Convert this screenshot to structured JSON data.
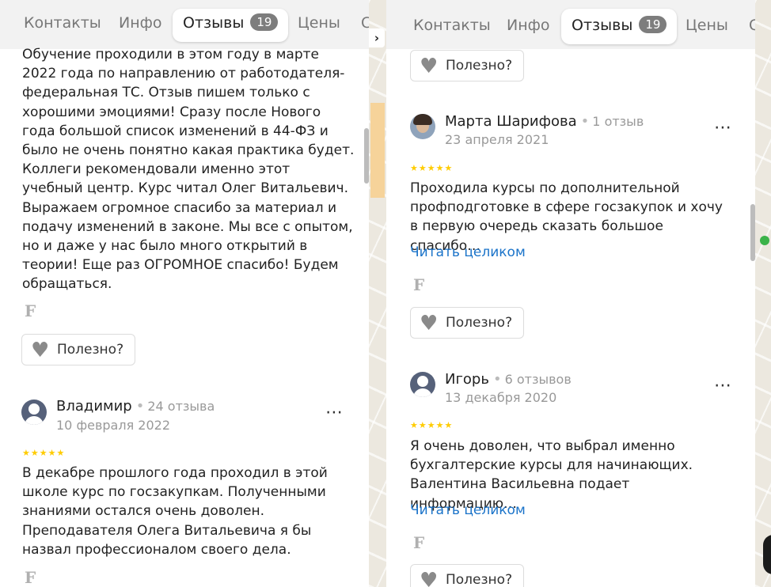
{
  "tabs": [
    {
      "label": "Контакты"
    },
    {
      "label": "Инфо"
    },
    {
      "label": "Отзывы",
      "badge": "19",
      "active": true
    },
    {
      "label": "Цены"
    },
    {
      "label": "С"
    }
  ],
  "useful_label": "Полезно?",
  "read_more_label": "Читать целиком",
  "left": {
    "first_review_text": "Обучение проходили в этом году в марте 2022 года по направлению от работодателя-федеральная ТС. Отзыв пишем только с хорошими эмоциями! Сразу после Нового года большой список изменений в 44-ФЗ и было не очень понятно какая практика будет. Коллеги рекомендовали именно этот учебный центр. Курс читал Олег Витальевич. Выражаем огромное спасибо за материал и подачу изменений в законе. Мы все с опытом, но и даже у нас было много открытий в теории! Еще раз ОГРОМНОЕ спасибо! Будем обращаться.",
    "review2": {
      "name": "Владимир",
      "count": "24 отзыва",
      "date": "10 февраля 2022",
      "stars": "★★★★★",
      "text": "В декабре прошлого года проходил в этой школе курс по госзакупкам. Полученными знаниями остался очень доволен. Преподавателя Олега Витальевича я бы назвал профессионалом своего дела."
    }
  },
  "right": {
    "review1": {
      "name": "Марта Шарифова",
      "count": "1 отзыв",
      "date": "23 апреля 2021",
      "stars": "★★★★★",
      "text": "Проходила курсы по дополнительной профподготовке в сфере госзакупок и хочу в первую очередь сказать большое спасибо…"
    },
    "review2": {
      "name": "Игорь",
      "count": "6 отзывов",
      "date": "13 декабря 2020",
      "stars": "★★★★★",
      "text": "Я очень доволен, что выбрал именно бухгалтерские курсы для начинающих. Валентина Васильевна подает информацию…"
    }
  },
  "icons": {
    "more": "⋯",
    "heart": "♥",
    "flag": "F",
    "chevron": "›"
  },
  "colors": {
    "stars": "#ffcc00",
    "link": "#1a73c9",
    "tabbar": "#f2f2f2"
  }
}
